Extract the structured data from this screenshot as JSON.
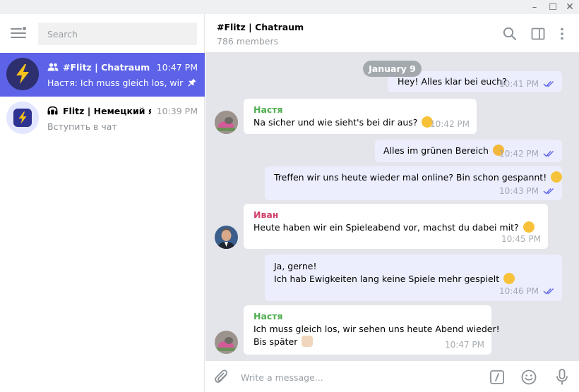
{
  "window": {
    "minimize": "–",
    "maximize": "☐",
    "close": "✕"
  },
  "sidebar": {
    "search_placeholder": "Search",
    "chats": [
      {
        "name": "#Flitz | Chatraum",
        "time": "10:47 PM",
        "preview": "Настя: Ich muss gleich los, wir sehen uns heute Abend wieder!",
        "type_icon": "group-icon",
        "pinned": true,
        "active": true
      },
      {
        "name": "Flitz | Немецкий язык",
        "time": "10:39 PM",
        "preview": "Вступить в чат",
        "type_icon": "channel-icon",
        "pinned": false,
        "active": false
      }
    ]
  },
  "chat": {
    "title": "#Flitz | Chatraum",
    "subtitle": "786 members",
    "date_separator": "January 9",
    "messages": [
      {
        "direction": "out",
        "text": "Hey! Alles klar bei euch?",
        "time": "10:41 PM",
        "read": true
      },
      {
        "direction": "in",
        "sender": "Настя",
        "sender_color": "#4fae4e",
        "text": "Na sicher und wie sieht's bei dir aus?",
        "emoji": "smile",
        "time": "10:42 PM"
      },
      {
        "direction": "out",
        "text": "Alles im grünen Bereich",
        "emoji": "blush",
        "time": "10:42 PM",
        "read": true
      },
      {
        "direction": "out",
        "text": "Treffen wir uns heute wieder mal online? Bin schon gespannt!",
        "emoji": "grin",
        "time": "10:43 PM",
        "read": true
      },
      {
        "direction": "in",
        "sender": "Иван",
        "sender_color": "#d0426b",
        "text": "Heute haben wir ein Spieleabend vor, machst du dabei mit?",
        "emoji": "smile",
        "time": "10:45 PM"
      },
      {
        "direction": "out",
        "text_line1": "Ja, gerne!",
        "text_line2": "Ich hab Ewigkeiten lang keine Spiele mehr gespielt",
        "emoji": "smile",
        "time": "10:46 PM",
        "read": true
      },
      {
        "direction": "in",
        "sender": "Настя",
        "sender_color": "#4fae4e",
        "text_line1": "Ich muss gleich los, wir sehen uns heute Abend wieder!",
        "text_line2": "Bis später",
        "emoji": "wave",
        "time": "10:47 PM"
      }
    ]
  },
  "composer": {
    "placeholder": "Write a message..."
  },
  "colors": {
    "accent": "#5c63e8",
    "outgoing_bubble": "#eceefd",
    "chat_background": "#e3e5ea",
    "check_marks": "#5c63e8"
  }
}
